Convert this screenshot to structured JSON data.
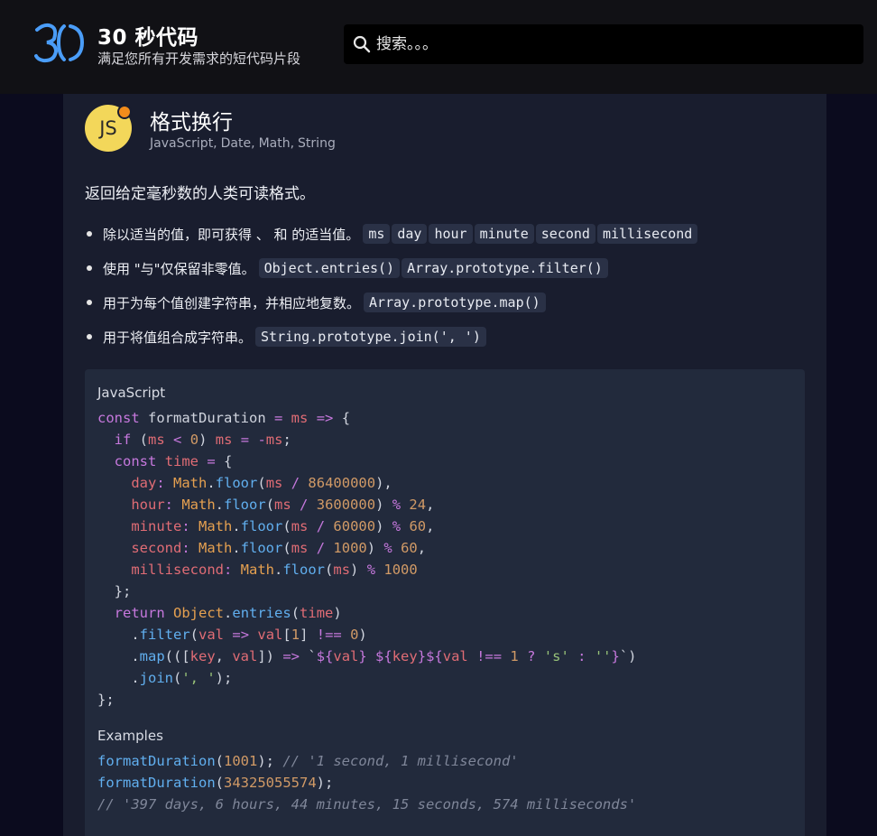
{
  "header": {
    "brand_title": "30 秒代码",
    "brand_subtitle": "满足您所有开发需求的短代码片段",
    "search_placeholder": "搜索。。。"
  },
  "snippet": {
    "badge": "JS",
    "title": "格式换行",
    "tags": [
      "JavaScript,",
      "Date,",
      "Math,",
      "String"
    ],
    "description": "返回给定毫秒数的人类可读格式。",
    "bullets": [
      {
        "text": "除以适当的值，即可获得 、 和 的适当值。",
        "chips": [
          "ms",
          "day",
          "hour",
          "minute",
          "second",
          "millisecond"
        ]
      },
      {
        "text": "使用 \"与\"仅保留非零值。",
        "chips": [
          "Object.entries()",
          "Array.prototype.filter()"
        ]
      },
      {
        "text": "用于为每个值创建字符串，并相应地复数。",
        "chips": [
          "Array.prototype.map()"
        ]
      },
      {
        "text": "用于将值组合成字符串。",
        "chips": [
          "String.prototype.join(', ')"
        ]
      }
    ],
    "code_language": "JavaScript",
    "code": "const formatDuration = ms => {\n  if (ms < 0) ms = -ms;\n  const time = {\n    day: Math.floor(ms / 86400000),\n    hour: Math.floor(ms / 3600000) % 24,\n    minute: Math.floor(ms / 60000) % 60,\n    second: Math.floor(ms / 1000) % 60,\n    millisecond: Math.floor(ms) % 1000\n  };\n  return Object.entries(time)\n    .filter(val => val[1] !== 0)\n    .map(([key, val]) => `${val} ${key}${val !== 1 ? 's' : ''}`)\n    .join(', ');\n};",
    "examples_label": "Examples",
    "examples": "formatDuration(1001); // '1 second, 1 millisecond'\nformatDuration(34325055574);\n// '397 days, 6 hours, 44 minutes, 15 seconds, 574 milliseconds'"
  },
  "colors": {
    "accent_blue": "#4a9df8",
    "badge_yellow": "#f3d75a",
    "badge_dot_orange": "#f28c1b"
  },
  "icons": [
    "logo-30-icon",
    "search-icon"
  ]
}
